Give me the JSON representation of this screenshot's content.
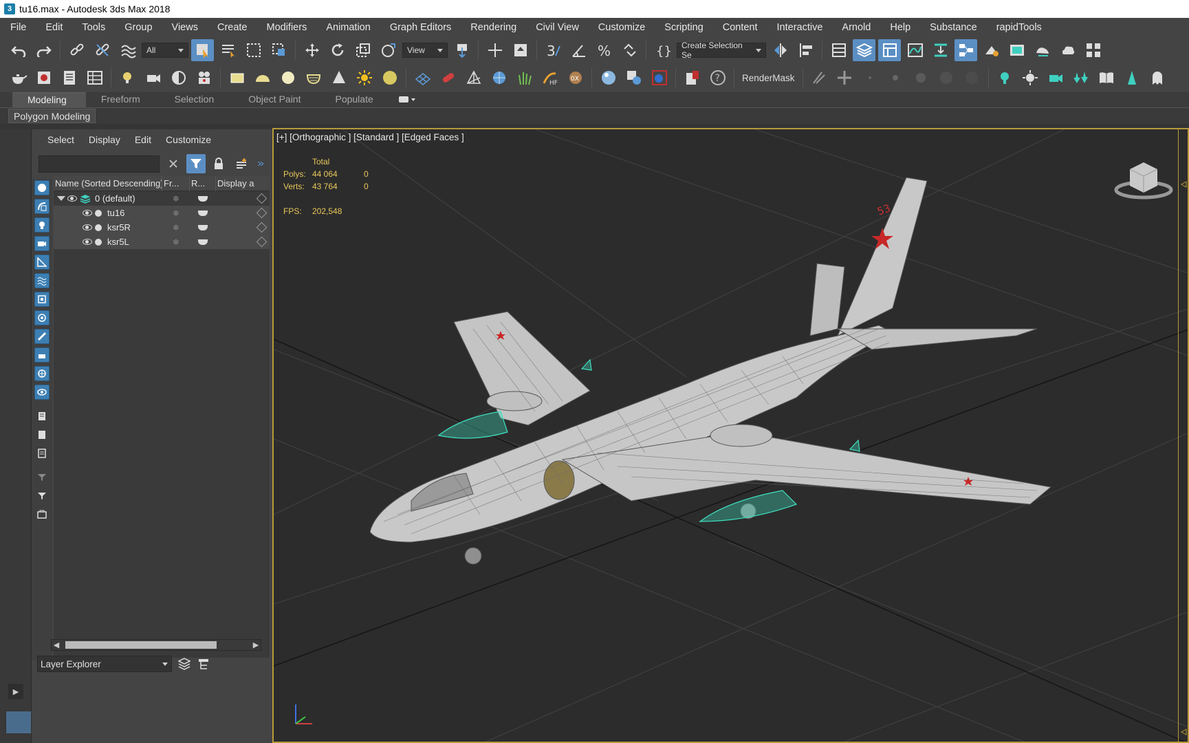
{
  "window": {
    "title": "tu16.max - Autodesk 3ds Max 2018",
    "app_icon": "3"
  },
  "menu": [
    "File",
    "Edit",
    "Tools",
    "Group",
    "Views",
    "Create",
    "Modifiers",
    "Animation",
    "Graph Editors",
    "Rendering",
    "Civil View",
    "Customize",
    "Scripting",
    "Content",
    "Interactive",
    "Arnold",
    "Help",
    "Substance",
    "rapidTools"
  ],
  "toolbar1": {
    "selection_filter": "All",
    "coordinate_system": "View",
    "selection_set_placeholder": "Create Selection Se"
  },
  "toolbar2": {
    "rendermask_label": "RenderMask"
  },
  "ribbon": {
    "tabs": [
      "Modeling",
      "Freeform",
      "Selection",
      "Object Paint",
      "Populate"
    ],
    "active_tab": "Modeling",
    "panel_button": "Polygon Modeling"
  },
  "explorer": {
    "menu": [
      "Select",
      "Display",
      "Edit",
      "Customize"
    ],
    "columns": [
      "Name (Sorted Descending)",
      "Fr...",
      "R...",
      "Display a"
    ],
    "layer": "0 (default)",
    "objects": [
      "tu16",
      "ksr5R",
      "ksr5L"
    ],
    "footer_mode": "Layer Explorer"
  },
  "viewport": {
    "label": "[+] [Orthographic ] [Standard ] [Edged Faces ]",
    "stats": {
      "total_label": "Total",
      "polys_label": "Polys:",
      "polys_total": "44 064",
      "polys_selected": "0",
      "verts_label": "Verts:",
      "verts_total": "43 764",
      "verts_selected": "0",
      "fps_label": "FPS:",
      "fps_value": "202,548"
    },
    "model_marking": "53"
  },
  "colors": {
    "accent": "#5b8fc4",
    "viewport_border": "#b89b3a",
    "stats_text": "#e8c85a",
    "missile_wireframe": "#3fe0c0",
    "airframe": "#c8c8c8"
  }
}
